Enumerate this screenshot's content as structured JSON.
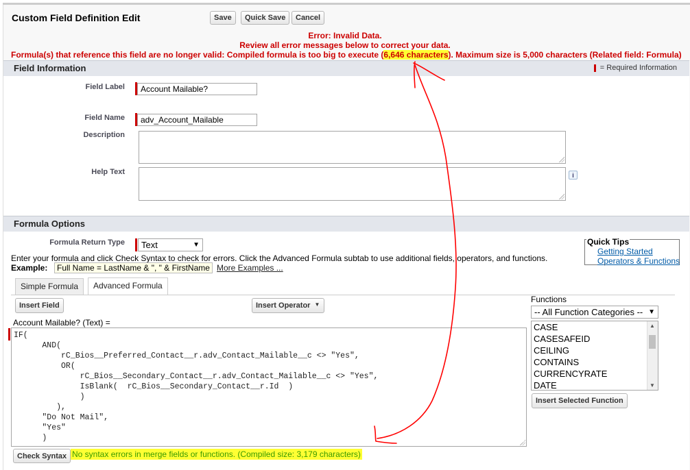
{
  "header": {
    "title": "Custom Field Definition Edit",
    "save_label": "Save",
    "quick_save_label": "Quick Save",
    "cancel_label": "Cancel"
  },
  "errors": {
    "line1": "Error: Invalid Data.",
    "line2": "Review all error messages below to correct your data.",
    "line3_pre": "Formula(s) that reference this field are no longer valid: Compiled formula is too big to execute (",
    "line3_highlight": "6,646 characters",
    "line3_post": "). Maximum size is 5,000 characters (Related field: Formula)"
  },
  "field_info": {
    "section_title": "Field Information",
    "required_info": "= Required Information",
    "field_label_label": "Field Label",
    "field_label_value": "Account Mailable?",
    "field_name_label": "Field Name",
    "field_name_value": "adv_Account_Mailable",
    "description_label": "Description",
    "help_text_label": "Help Text",
    "info_icon": "i"
  },
  "formula_options": {
    "section_title": "Formula Options",
    "return_type_label": "Formula Return Type",
    "return_type_value": "Text",
    "instructions": "Enter your formula and click Check Syntax to check for errors. Click the Advanced Formula subtab to use additional fields, operators, and functions.",
    "example_label": "Example:",
    "example_value": "Full Name = LastName & \", \" & FirstName",
    "more_examples": "More Examples ...",
    "quick_tips": {
      "title": "Quick Tips",
      "links": [
        "Getting Started",
        "Operators & Functions"
      ]
    }
  },
  "tabs": [
    "Simple Formula",
    "Advanced Formula"
  ],
  "editor": {
    "insert_field": "Insert Field",
    "insert_operator": "Insert Operator",
    "formula_label": "Account Mailable? (Text) =",
    "formula_text": "IF(\n      AND(\n          rC_Bios__Preferred_Contact__r.adv_Contact_Mailable__c <> \"Yes\",\n          OR(\n              rC_Bios__Secondary_Contact__r.adv_Contact_Mailable__c <> \"Yes\",\n              IsBlank(  rC_Bios__Secondary_Contact__r.Id  )\n              )\n         ),\n      \"Do Not Mail\",\n      \"Yes\"\n      )",
    "check_syntax": "Check Syntax",
    "syntax_result": "No syntax errors in merge fields or functions. (Compiled size: 3,179 characters)"
  },
  "functions": {
    "label": "Functions",
    "category": "-- All Function Categories --",
    "items": [
      "CASE",
      "CASESAFEID",
      "CEILING",
      "CONTAINS",
      "CURRENCYRATE",
      "DATE"
    ],
    "insert_selected": "Insert Selected Function"
  },
  "colors": {
    "error_red": "#cc0000",
    "highlight_yellow": "#ffff33",
    "success_green": "#3a9a00",
    "section_bg": "#e3e6ec",
    "annotation_red": "#ff0000"
  }
}
